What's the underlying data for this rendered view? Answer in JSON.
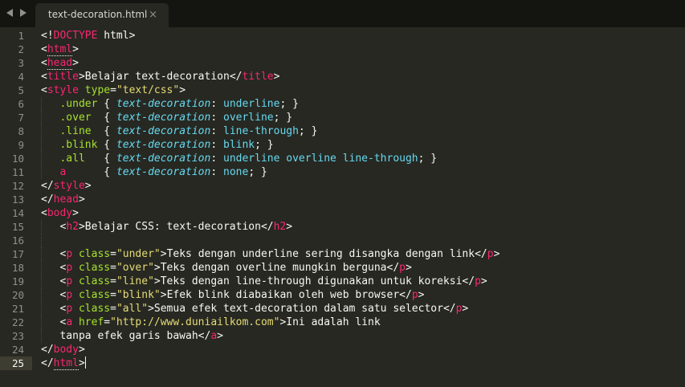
{
  "tab": {
    "title": "text-decoration.html",
    "close": "×"
  },
  "editor": {
    "current_line": 25,
    "lines": [
      [
        {
          "t": "p",
          "v": "<!"
        },
        {
          "t": "kw",
          "v": "DOCTYPE"
        },
        {
          "t": "txt",
          "v": " html"
        },
        {
          "t": "p",
          "v": ">"
        }
      ],
      [
        {
          "t": "p",
          "v": "<"
        },
        {
          "t": "tag",
          "v": "html",
          "dot": true
        },
        {
          "t": "p",
          "v": ">"
        }
      ],
      [
        {
          "t": "p",
          "v": "<"
        },
        {
          "t": "tag",
          "v": "head",
          "dot": true
        },
        {
          "t": "p",
          "v": ">"
        }
      ],
      [
        {
          "t": "p",
          "v": "<"
        },
        {
          "t": "tag",
          "v": "title"
        },
        {
          "t": "p",
          "v": ">"
        },
        {
          "t": "txt",
          "v": "Belajar text-decoration"
        },
        {
          "t": "p",
          "v": "</"
        },
        {
          "t": "tag",
          "v": "title"
        },
        {
          "t": "p",
          "v": ">"
        }
      ],
      [
        {
          "t": "p",
          "v": "<"
        },
        {
          "t": "tag",
          "v": "style"
        },
        {
          "t": "txt",
          "v": " "
        },
        {
          "t": "attr",
          "v": "type"
        },
        {
          "t": "p",
          "v": "="
        },
        {
          "t": "str",
          "v": "\"text/css\""
        },
        {
          "t": "p",
          "v": ">"
        }
      ],
      [
        {
          "t": "txt",
          "v": "   "
        },
        {
          "t": "sel",
          "v": ".under"
        },
        {
          "t": "p",
          "v": " { "
        },
        {
          "t": "prop",
          "v": "text-decoration"
        },
        {
          "t": "p",
          "v": ": "
        },
        {
          "t": "val",
          "v": "underline"
        },
        {
          "t": "p",
          "v": "; }"
        }
      ],
      [
        {
          "t": "txt",
          "v": "   "
        },
        {
          "t": "sel",
          "v": ".over"
        },
        {
          "t": "p",
          "v": "  { "
        },
        {
          "t": "prop",
          "v": "text-decoration"
        },
        {
          "t": "p",
          "v": ": "
        },
        {
          "t": "val",
          "v": "overline"
        },
        {
          "t": "p",
          "v": "; }"
        }
      ],
      [
        {
          "t": "txt",
          "v": "   "
        },
        {
          "t": "sel",
          "v": ".line"
        },
        {
          "t": "p",
          "v": "  { "
        },
        {
          "t": "prop",
          "v": "text-decoration"
        },
        {
          "t": "p",
          "v": ": "
        },
        {
          "t": "val",
          "v": "line-through"
        },
        {
          "t": "p",
          "v": "; }"
        }
      ],
      [
        {
          "t": "txt",
          "v": "   "
        },
        {
          "t": "sel",
          "v": ".blink"
        },
        {
          "t": "p",
          "v": " { "
        },
        {
          "t": "prop",
          "v": "text-decoration"
        },
        {
          "t": "p",
          "v": ": "
        },
        {
          "t": "val",
          "v": "blink"
        },
        {
          "t": "p",
          "v": "; }"
        }
      ],
      [
        {
          "t": "txt",
          "v": "   "
        },
        {
          "t": "sel",
          "v": ".all"
        },
        {
          "t": "p",
          "v": "   { "
        },
        {
          "t": "prop",
          "v": "text-decoration"
        },
        {
          "t": "p",
          "v": ": "
        },
        {
          "t": "val",
          "v": "underline overline line-through"
        },
        {
          "t": "p",
          "v": "; }"
        }
      ],
      [
        {
          "t": "txt",
          "v": "   "
        },
        {
          "t": "kw",
          "v": "a"
        },
        {
          "t": "p",
          "v": "      { "
        },
        {
          "t": "prop",
          "v": "text-decoration"
        },
        {
          "t": "p",
          "v": ": "
        },
        {
          "t": "val",
          "v": "none"
        },
        {
          "t": "p",
          "v": "; }"
        }
      ],
      [
        {
          "t": "p",
          "v": "</"
        },
        {
          "t": "tag",
          "v": "style"
        },
        {
          "t": "p",
          "v": ">"
        }
      ],
      [
        {
          "t": "p",
          "v": "</"
        },
        {
          "t": "tag",
          "v": "head"
        },
        {
          "t": "p",
          "v": ">"
        }
      ],
      [
        {
          "t": "p",
          "v": "<"
        },
        {
          "t": "tag",
          "v": "body"
        },
        {
          "t": "p",
          "v": ">"
        }
      ],
      [
        {
          "t": "txt",
          "v": "   "
        },
        {
          "t": "p",
          "v": "<"
        },
        {
          "t": "tag",
          "v": "h2"
        },
        {
          "t": "p",
          "v": ">"
        },
        {
          "t": "txt",
          "v": "Belajar CSS: text-decoration"
        },
        {
          "t": "p",
          "v": "</"
        },
        {
          "t": "tag",
          "v": "h2"
        },
        {
          "t": "p",
          "v": ">"
        }
      ],
      [],
      [
        {
          "t": "txt",
          "v": "   "
        },
        {
          "t": "p",
          "v": "<"
        },
        {
          "t": "tag",
          "v": "p"
        },
        {
          "t": "txt",
          "v": " "
        },
        {
          "t": "attr",
          "v": "class"
        },
        {
          "t": "p",
          "v": "="
        },
        {
          "t": "str",
          "v": "\"under\""
        },
        {
          "t": "p",
          "v": ">"
        },
        {
          "t": "txt",
          "v": "Teks dengan underline sering disangka dengan link"
        },
        {
          "t": "p",
          "v": "</"
        },
        {
          "t": "tag",
          "v": "p"
        },
        {
          "t": "p",
          "v": ">"
        }
      ],
      [
        {
          "t": "txt",
          "v": "   "
        },
        {
          "t": "p",
          "v": "<"
        },
        {
          "t": "tag",
          "v": "p"
        },
        {
          "t": "txt",
          "v": " "
        },
        {
          "t": "attr",
          "v": "class"
        },
        {
          "t": "p",
          "v": "="
        },
        {
          "t": "str",
          "v": "\"over\""
        },
        {
          "t": "p",
          "v": ">"
        },
        {
          "t": "txt",
          "v": "Teks dengan overline mungkin berguna"
        },
        {
          "t": "p",
          "v": "</"
        },
        {
          "t": "tag",
          "v": "p"
        },
        {
          "t": "p",
          "v": ">"
        }
      ],
      [
        {
          "t": "txt",
          "v": "   "
        },
        {
          "t": "p",
          "v": "<"
        },
        {
          "t": "tag",
          "v": "p"
        },
        {
          "t": "txt",
          "v": " "
        },
        {
          "t": "attr",
          "v": "class"
        },
        {
          "t": "p",
          "v": "="
        },
        {
          "t": "str",
          "v": "\"line\""
        },
        {
          "t": "p",
          "v": ">"
        },
        {
          "t": "txt",
          "v": "Teks dengan line-through digunakan untuk koreksi"
        },
        {
          "t": "p",
          "v": "</"
        },
        {
          "t": "tag",
          "v": "p"
        },
        {
          "t": "p",
          "v": ">"
        }
      ],
      [
        {
          "t": "txt",
          "v": "   "
        },
        {
          "t": "p",
          "v": "<"
        },
        {
          "t": "tag",
          "v": "p"
        },
        {
          "t": "txt",
          "v": " "
        },
        {
          "t": "attr",
          "v": "class"
        },
        {
          "t": "p",
          "v": "="
        },
        {
          "t": "str",
          "v": "\"blink\""
        },
        {
          "t": "p",
          "v": ">"
        },
        {
          "t": "txt",
          "v": "Efek blink diabaikan oleh web browser"
        },
        {
          "t": "p",
          "v": "</"
        },
        {
          "t": "tag",
          "v": "p"
        },
        {
          "t": "p",
          "v": ">"
        }
      ],
      [
        {
          "t": "txt",
          "v": "   "
        },
        {
          "t": "p",
          "v": "<"
        },
        {
          "t": "tag",
          "v": "p"
        },
        {
          "t": "txt",
          "v": " "
        },
        {
          "t": "attr",
          "v": "class"
        },
        {
          "t": "p",
          "v": "="
        },
        {
          "t": "str",
          "v": "\"all\""
        },
        {
          "t": "p",
          "v": ">"
        },
        {
          "t": "txt",
          "v": "Semua efek text-decoration dalam satu selector"
        },
        {
          "t": "p",
          "v": "</"
        },
        {
          "t": "tag",
          "v": "p"
        },
        {
          "t": "p",
          "v": ">"
        }
      ],
      [
        {
          "t": "txt",
          "v": "   "
        },
        {
          "t": "p",
          "v": "<"
        },
        {
          "t": "tag",
          "v": "a"
        },
        {
          "t": "txt",
          "v": " "
        },
        {
          "t": "attr",
          "v": "href"
        },
        {
          "t": "p",
          "v": "="
        },
        {
          "t": "str",
          "v": "\"http://www.duniailkom.com\""
        },
        {
          "t": "p",
          "v": ">"
        },
        {
          "t": "txt",
          "v": "Ini adalah link"
        }
      ],
      [
        {
          "t": "txt",
          "v": "   tanpa efek garis bawah"
        },
        {
          "t": "p",
          "v": "</"
        },
        {
          "t": "tag",
          "v": "a"
        },
        {
          "t": "p",
          "v": ">"
        }
      ],
      [
        {
          "t": "p",
          "v": "</"
        },
        {
          "t": "tag",
          "v": "body"
        },
        {
          "t": "p",
          "v": ">"
        }
      ],
      [
        {
          "t": "p",
          "v": "</"
        },
        {
          "t": "tag",
          "v": "html",
          "dot": true
        },
        {
          "t": "p",
          "v": ">"
        }
      ]
    ]
  }
}
